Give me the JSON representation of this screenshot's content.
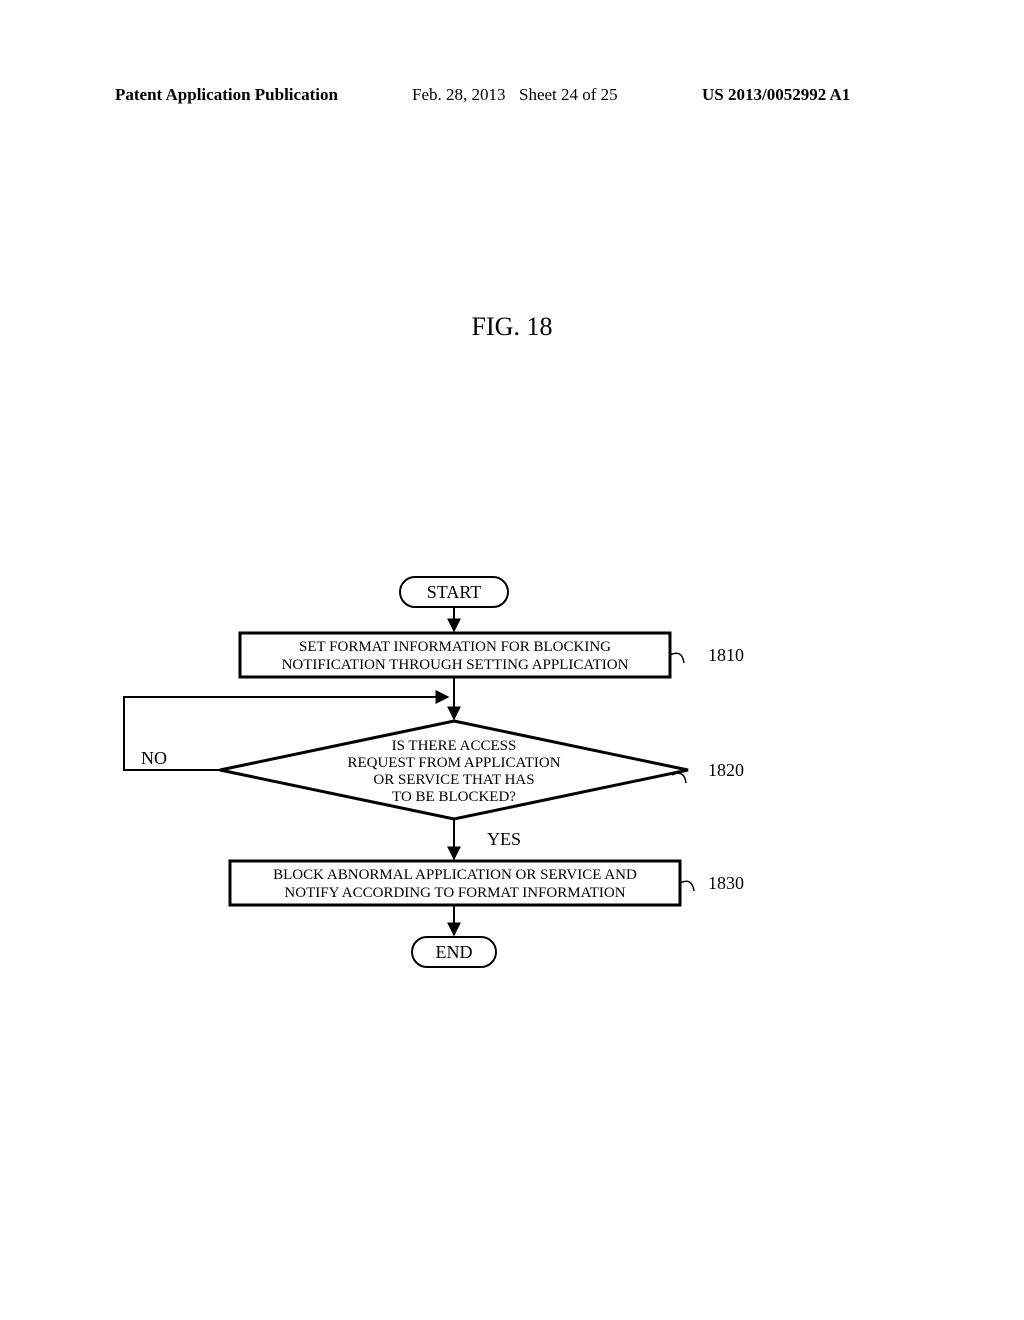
{
  "header": {
    "pub_type": "Patent Application Publication",
    "date": "Feb. 28, 2013",
    "sheet": "Sheet 24 of 25",
    "pub_number": "US 2013/0052992 A1"
  },
  "figure": {
    "title": "FIG. 18"
  },
  "flowchart": {
    "start": "START",
    "end": "END",
    "step1": {
      "line1": "SET FORMAT INFORMATION FOR BLOCKING",
      "line2": "NOTIFICATION THROUGH SETTING APPLICATION",
      "ref": "1810"
    },
    "decision": {
      "line1": "IS THERE ACCESS",
      "line2": "REQUEST FROM APPLICATION",
      "line3": "OR SERVICE THAT HAS",
      "line4": "TO BE BLOCKED?",
      "ref": "1820",
      "yes": "YES",
      "no": "NO"
    },
    "step3": {
      "line1": "BLOCK ABNORMAL APPLICATION OR SERVICE AND",
      "line2": "NOTIFY ACCORDING TO FORMAT INFORMATION",
      "ref": "1830"
    }
  }
}
